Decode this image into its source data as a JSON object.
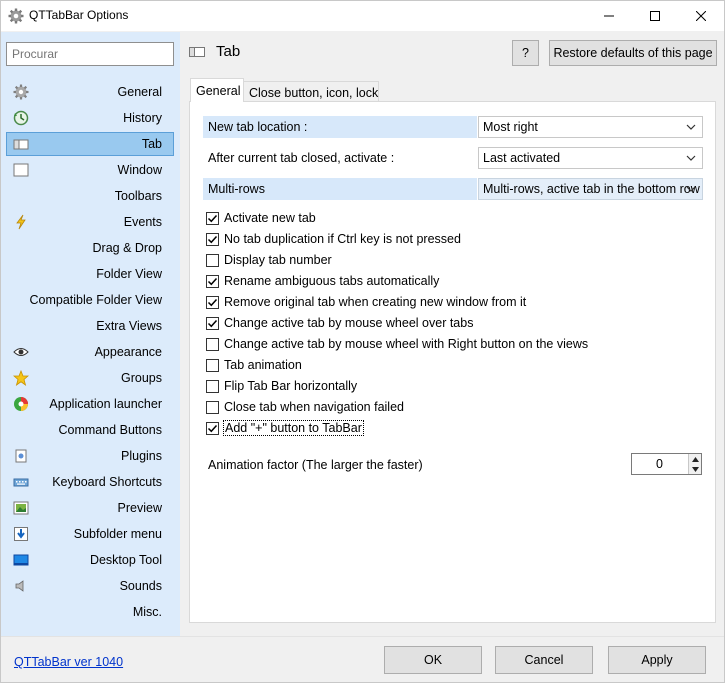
{
  "window": {
    "title": "QTTabBar Options"
  },
  "sidebar": {
    "search_placeholder": "Procurar",
    "items": [
      {
        "label": "General",
        "icon": "gear-icon"
      },
      {
        "label": "History",
        "icon": "history-icon"
      },
      {
        "label": "Tab",
        "icon": "tab-icon",
        "selected": true
      },
      {
        "label": "Window",
        "icon": "window-icon"
      },
      {
        "label": "Toolbars",
        "icon": ""
      },
      {
        "label": "Events",
        "icon": "lightning-icon"
      },
      {
        "label": "Drag & Drop",
        "icon": ""
      },
      {
        "label": "Folder View",
        "icon": ""
      },
      {
        "label": "Compatible Folder View",
        "icon": ""
      },
      {
        "label": "Extra Views",
        "icon": ""
      },
      {
        "label": "Appearance",
        "icon": "eye-icon"
      },
      {
        "label": "Groups",
        "icon": "star-icon"
      },
      {
        "label": "Application launcher",
        "icon": "app-launcher-icon"
      },
      {
        "label": "Command Buttons",
        "icon": ""
      },
      {
        "label": "Plugins",
        "icon": "plugin-icon"
      },
      {
        "label": "Keyboard Shortcuts",
        "icon": "keyboard-icon"
      },
      {
        "label": "Preview",
        "icon": "preview-icon"
      },
      {
        "label": "Subfolder menu",
        "icon": "subfolder-icon"
      },
      {
        "label": "Desktop Tool",
        "icon": "desktop-icon"
      },
      {
        "label": "Sounds",
        "icon": "speaker-icon"
      },
      {
        "label": "Misc.",
        "icon": ""
      }
    ]
  },
  "header": {
    "title": "Tab",
    "help_label": "?",
    "restore_label": "Restore defaults of this page"
  },
  "tabs": [
    {
      "label": "General",
      "active": true
    },
    {
      "label": "Close button, icon, lock",
      "active": false
    }
  ],
  "settings": {
    "new_tab_location": {
      "label": "New tab location :",
      "value": "Most right"
    },
    "after_close": {
      "label": "After current tab closed, activate :",
      "value": "Last activated"
    },
    "multi_rows": {
      "label": "Multi-rows",
      "value": "Multi-rows, active tab in the bottom row"
    }
  },
  "checkboxes": [
    {
      "label": "Activate new tab",
      "checked": true
    },
    {
      "label": "No tab duplication if Ctrl key is not pressed",
      "checked": true
    },
    {
      "label": "Display tab number",
      "checked": false
    },
    {
      "label": "Rename ambiguous tabs automatically",
      "checked": true
    },
    {
      "label": "Remove original tab when creating new window from it",
      "checked": true
    },
    {
      "label": "Change active tab by mouse wheel over tabs",
      "checked": true
    },
    {
      "label": "Change active tab by mouse wheel with Right button on the views",
      "checked": false
    },
    {
      "label": "Tab animation",
      "checked": false
    },
    {
      "label": "Flip Tab Bar horizontally",
      "checked": false
    },
    {
      "label": "Close tab when navigation failed",
      "checked": false
    },
    {
      "label": "Add \"+\" button to TabBar",
      "checked": true
    }
  ],
  "animation": {
    "label": "Animation factor (The larger the faster)",
    "value": "0"
  },
  "footer": {
    "version_link": "QTTabBar ver 1040",
    "ok_label": "OK",
    "cancel_label": "Cancel",
    "apply_label": "Apply"
  },
  "colors": {
    "sidebar_bg": "#dcebfb",
    "selected_bg": "#99c9ef",
    "highlight_row": "#d7e8fa",
    "link": "#0033cc"
  }
}
